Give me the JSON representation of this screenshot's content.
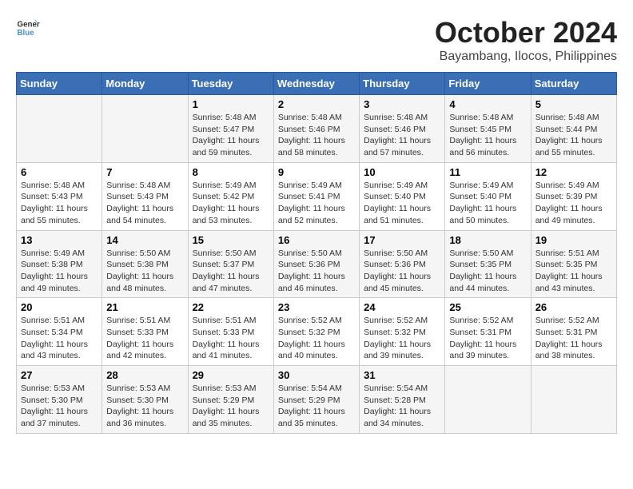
{
  "header": {
    "logo_line1": "General",
    "logo_line2": "Blue",
    "month": "October 2024",
    "location": "Bayambang, Ilocos, Philippines"
  },
  "weekdays": [
    "Sunday",
    "Monday",
    "Tuesday",
    "Wednesday",
    "Thursday",
    "Friday",
    "Saturday"
  ],
  "weeks": [
    [
      {
        "day": "",
        "info": ""
      },
      {
        "day": "",
        "info": ""
      },
      {
        "day": "1",
        "info": "Sunrise: 5:48 AM\nSunset: 5:47 PM\nDaylight: 11 hours and 59 minutes."
      },
      {
        "day": "2",
        "info": "Sunrise: 5:48 AM\nSunset: 5:46 PM\nDaylight: 11 hours and 58 minutes."
      },
      {
        "day": "3",
        "info": "Sunrise: 5:48 AM\nSunset: 5:46 PM\nDaylight: 11 hours and 57 minutes."
      },
      {
        "day": "4",
        "info": "Sunrise: 5:48 AM\nSunset: 5:45 PM\nDaylight: 11 hours and 56 minutes."
      },
      {
        "day": "5",
        "info": "Sunrise: 5:48 AM\nSunset: 5:44 PM\nDaylight: 11 hours and 55 minutes."
      }
    ],
    [
      {
        "day": "6",
        "info": "Sunrise: 5:48 AM\nSunset: 5:43 PM\nDaylight: 11 hours and 55 minutes."
      },
      {
        "day": "7",
        "info": "Sunrise: 5:48 AM\nSunset: 5:43 PM\nDaylight: 11 hours and 54 minutes."
      },
      {
        "day": "8",
        "info": "Sunrise: 5:49 AM\nSunset: 5:42 PM\nDaylight: 11 hours and 53 minutes."
      },
      {
        "day": "9",
        "info": "Sunrise: 5:49 AM\nSunset: 5:41 PM\nDaylight: 11 hours and 52 minutes."
      },
      {
        "day": "10",
        "info": "Sunrise: 5:49 AM\nSunset: 5:40 PM\nDaylight: 11 hours and 51 minutes."
      },
      {
        "day": "11",
        "info": "Sunrise: 5:49 AM\nSunset: 5:40 PM\nDaylight: 11 hours and 50 minutes."
      },
      {
        "day": "12",
        "info": "Sunrise: 5:49 AM\nSunset: 5:39 PM\nDaylight: 11 hours and 49 minutes."
      }
    ],
    [
      {
        "day": "13",
        "info": "Sunrise: 5:49 AM\nSunset: 5:38 PM\nDaylight: 11 hours and 49 minutes."
      },
      {
        "day": "14",
        "info": "Sunrise: 5:50 AM\nSunset: 5:38 PM\nDaylight: 11 hours and 48 minutes."
      },
      {
        "day": "15",
        "info": "Sunrise: 5:50 AM\nSunset: 5:37 PM\nDaylight: 11 hours and 47 minutes."
      },
      {
        "day": "16",
        "info": "Sunrise: 5:50 AM\nSunset: 5:36 PM\nDaylight: 11 hours and 46 minutes."
      },
      {
        "day": "17",
        "info": "Sunrise: 5:50 AM\nSunset: 5:36 PM\nDaylight: 11 hours and 45 minutes."
      },
      {
        "day": "18",
        "info": "Sunrise: 5:50 AM\nSunset: 5:35 PM\nDaylight: 11 hours and 44 minutes."
      },
      {
        "day": "19",
        "info": "Sunrise: 5:51 AM\nSunset: 5:35 PM\nDaylight: 11 hours and 43 minutes."
      }
    ],
    [
      {
        "day": "20",
        "info": "Sunrise: 5:51 AM\nSunset: 5:34 PM\nDaylight: 11 hours and 43 minutes."
      },
      {
        "day": "21",
        "info": "Sunrise: 5:51 AM\nSunset: 5:33 PM\nDaylight: 11 hours and 42 minutes."
      },
      {
        "day": "22",
        "info": "Sunrise: 5:51 AM\nSunset: 5:33 PM\nDaylight: 11 hours and 41 minutes."
      },
      {
        "day": "23",
        "info": "Sunrise: 5:52 AM\nSunset: 5:32 PM\nDaylight: 11 hours and 40 minutes."
      },
      {
        "day": "24",
        "info": "Sunrise: 5:52 AM\nSunset: 5:32 PM\nDaylight: 11 hours and 39 minutes."
      },
      {
        "day": "25",
        "info": "Sunrise: 5:52 AM\nSunset: 5:31 PM\nDaylight: 11 hours and 39 minutes."
      },
      {
        "day": "26",
        "info": "Sunrise: 5:52 AM\nSunset: 5:31 PM\nDaylight: 11 hours and 38 minutes."
      }
    ],
    [
      {
        "day": "27",
        "info": "Sunrise: 5:53 AM\nSunset: 5:30 PM\nDaylight: 11 hours and 37 minutes."
      },
      {
        "day": "28",
        "info": "Sunrise: 5:53 AM\nSunset: 5:30 PM\nDaylight: 11 hours and 36 minutes."
      },
      {
        "day": "29",
        "info": "Sunrise: 5:53 AM\nSunset: 5:29 PM\nDaylight: 11 hours and 35 minutes."
      },
      {
        "day": "30",
        "info": "Sunrise: 5:54 AM\nSunset: 5:29 PM\nDaylight: 11 hours and 35 minutes."
      },
      {
        "day": "31",
        "info": "Sunrise: 5:54 AM\nSunset: 5:28 PM\nDaylight: 11 hours and 34 minutes."
      },
      {
        "day": "",
        "info": ""
      },
      {
        "day": "",
        "info": ""
      }
    ]
  ]
}
